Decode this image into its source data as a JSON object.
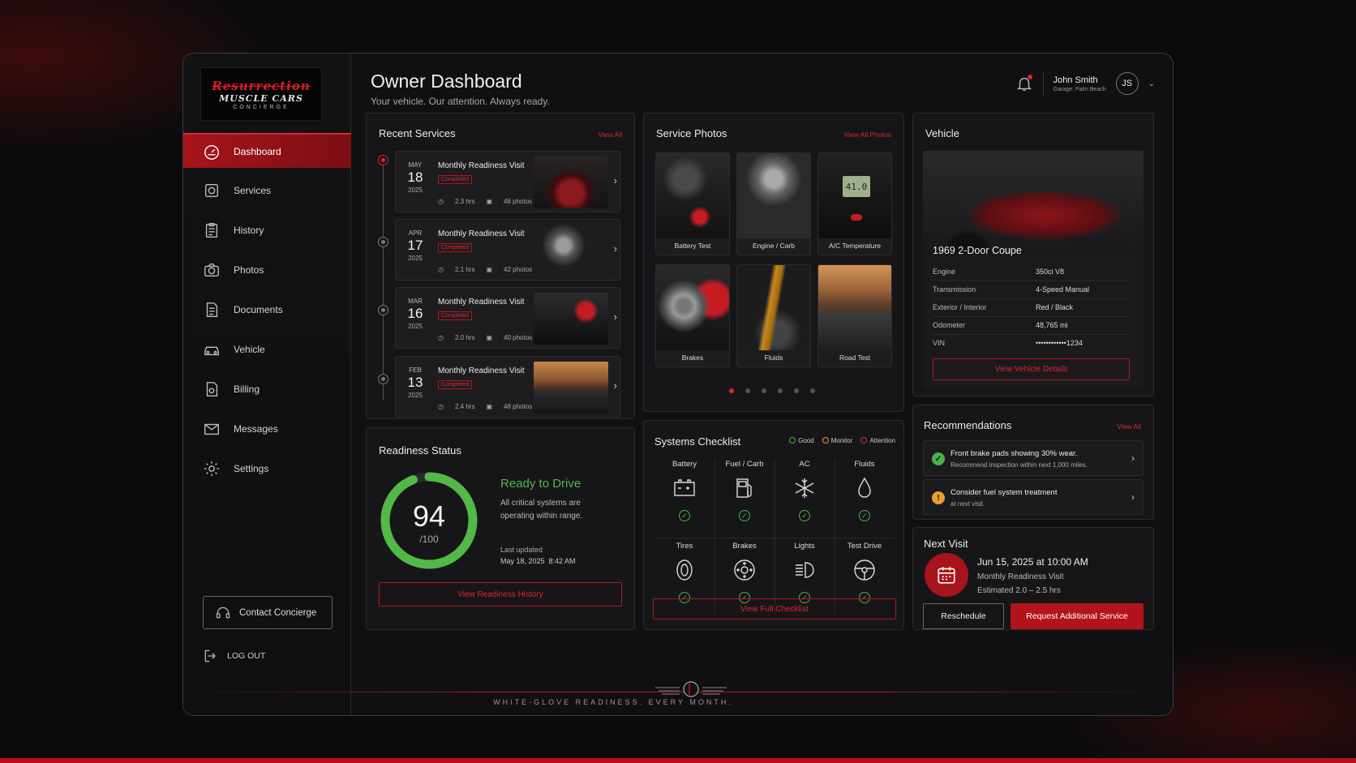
{
  "brand": {
    "line1": "Resurrection",
    "line2": "MUSCLE CARS",
    "line3": "CONCIERGE"
  },
  "header": {
    "title": "Owner Dashboard",
    "subtitle": "Your vehicle. Our attention. Always ready.",
    "user_name": "John Smith",
    "user_garage": "Garage: Palm Beach",
    "avatar_initials": "JS"
  },
  "sidebar": {
    "items": [
      {
        "label": "Dashboard",
        "icon": "speedometer-icon"
      },
      {
        "label": "Services",
        "icon": "wrench-icon"
      },
      {
        "label": "History",
        "icon": "clipboard-icon"
      },
      {
        "label": "Photos",
        "icon": "camera-icon"
      },
      {
        "label": "Documents",
        "icon": "document-icon"
      },
      {
        "label": "Vehicle",
        "icon": "car-icon"
      },
      {
        "label": "Billing",
        "icon": "invoice-icon"
      },
      {
        "label": "Messages",
        "icon": "envelope-icon"
      },
      {
        "label": "Settings",
        "icon": "gear-icon"
      }
    ],
    "contact_label": "Contact Concierge",
    "logout_label": "LOG OUT"
  },
  "recent_services": {
    "title": "Recent Services",
    "link": "View All",
    "items": [
      {
        "month": "MAY",
        "day": "18",
        "year": "2025",
        "title": "Monthly Readiness Visit",
        "status": "Completed",
        "hours": "2.3 hrs",
        "photos": "46 photos"
      },
      {
        "month": "APR",
        "day": "17",
        "year": "2025",
        "title": "Monthly Readiness Visit",
        "status": "Completed",
        "hours": "2.1 hrs",
        "photos": "42 photos"
      },
      {
        "month": "MAR",
        "day": "16",
        "year": "2025",
        "title": "Monthly Readiness Visit",
        "status": "Completed",
        "hours": "2.0 hrs",
        "photos": "40 photos"
      },
      {
        "month": "FEB",
        "day": "13",
        "year": "2025",
        "title": "Monthly Readiness Visit",
        "status": "Completed",
        "hours": "2.4 hrs",
        "photos": "48 photos"
      }
    ]
  },
  "service_photos": {
    "title": "Service Photos",
    "link": "View All Photos",
    "items": [
      "Battery Test",
      "Engine / Carb",
      "A/C Temperature",
      "Brakes",
      "Fluids",
      "Road Test"
    ],
    "gauge_reading": "41.0",
    "active_page": 1,
    "page_count": 6
  },
  "vehicle": {
    "title": "Vehicle",
    "model": "1969 2-Door Coupe",
    "specs": [
      {
        "k": "Engine",
        "v": "350ci V8"
      },
      {
        "k": "Transmission",
        "v": "4-Speed Manual"
      },
      {
        "k": "Exterior / Interior",
        "v": "Red / Black"
      },
      {
        "k": "Odometer",
        "v": "48,765 mi"
      },
      {
        "k": "VIN",
        "v": "••••••••••••1234"
      }
    ],
    "button": "View Vehicle Details"
  },
  "readiness": {
    "title": "Readiness Status",
    "score": "94",
    "score_max": "/100",
    "score_value": 94,
    "status": "Ready to Drive",
    "desc": "All critical systems are operating within range.",
    "updated_label": "Last updated",
    "updated_value": "May 18, 2025  8:42 AM",
    "button": "View Readiness History"
  },
  "systems": {
    "title": "Systems Checklist",
    "legend": [
      {
        "label": "Good",
        "color": "#48b24a"
      },
      {
        "label": "Monitor",
        "color": "#e8a02a"
      },
      {
        "label": "Attention",
        "color": "#e0262c"
      }
    ],
    "items": [
      {
        "label": "Battery",
        "icon": "battery-icon",
        "status": "good"
      },
      {
        "label": "Fuel / Carb",
        "icon": "fuel-pump-icon",
        "status": "good"
      },
      {
        "label": "AC",
        "icon": "snowflake-icon",
        "status": "good"
      },
      {
        "label": "Fluids",
        "icon": "droplet-icon",
        "status": "good"
      },
      {
        "label": "Tires",
        "icon": "tire-icon",
        "status": "good"
      },
      {
        "label": "Brakes",
        "icon": "brake-disc-icon",
        "status": "good"
      },
      {
        "label": "Lights",
        "icon": "headlight-icon",
        "status": "good"
      },
      {
        "label": "Test Drive",
        "icon": "steering-wheel-icon",
        "status": "good"
      }
    ],
    "button": "View Full Checklist"
  },
  "recommendations": {
    "title": "Recommendations",
    "link": "View All",
    "items": [
      {
        "t1": "Front brake pads showing 30% wear.",
        "t2": "Recommend inspection within next 1,000 miles.",
        "kind": "good"
      },
      {
        "t1": "Consider fuel system treatment",
        "t2": "at next visit.",
        "kind": "monitor"
      }
    ]
  },
  "next_visit": {
    "title": "Next Visit",
    "date": "Jun 15, 2025 at 10:00 AM",
    "type": "Monthly Readiness Visit",
    "estimate": "Estimated 2.0 – 2.5 hrs",
    "reschedule": "Reschedule",
    "request": "Request Additional Service"
  },
  "footer": {
    "tagline": "WHITE-GLOVE READINESS. EVERY MONTH."
  },
  "colors": {
    "accent": "#b3141b",
    "accent_bright": "#e0262c",
    "good": "#48b24a",
    "monitor": "#e8a02a",
    "panel": "#161618"
  }
}
